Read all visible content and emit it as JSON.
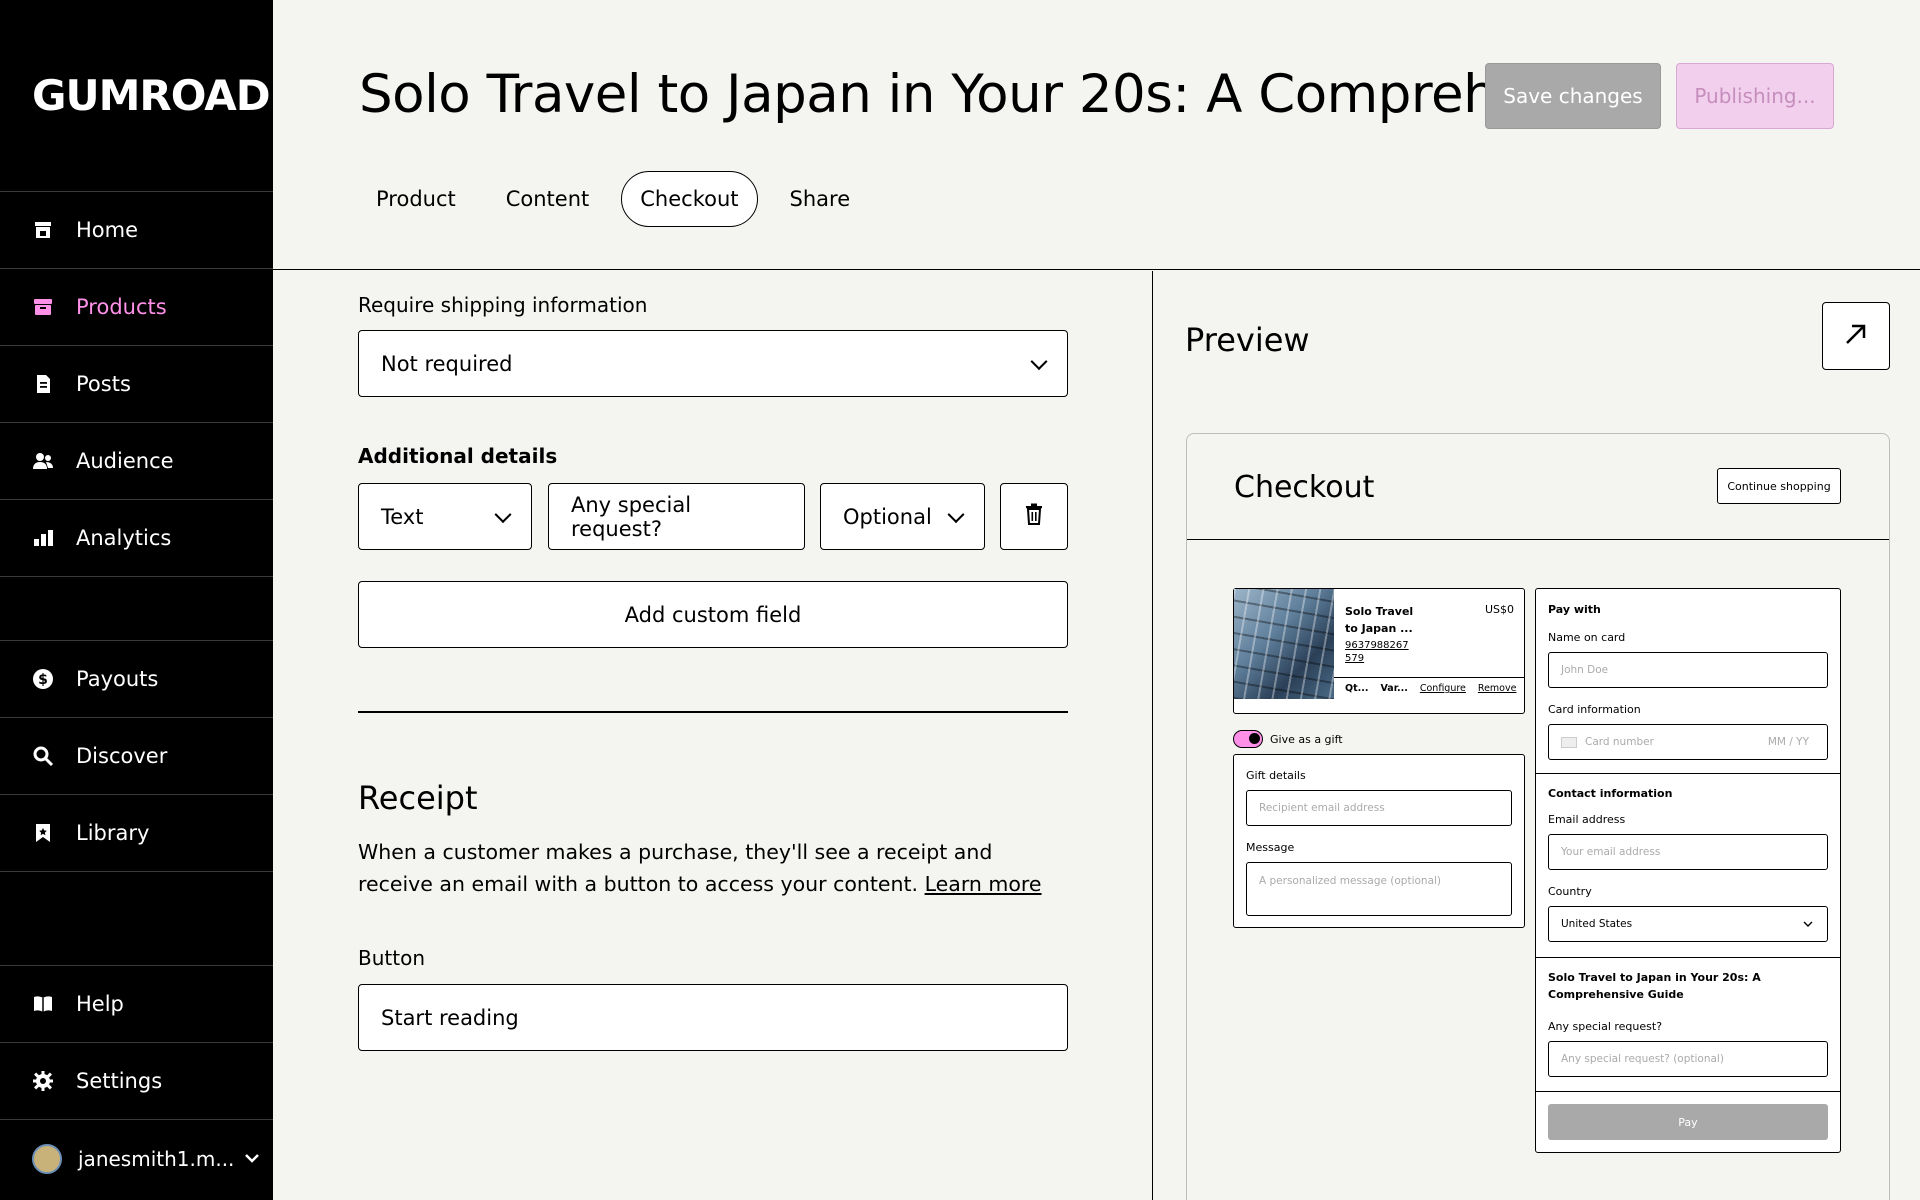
{
  "sidebar": {
    "logo": "Gumroad",
    "items": [
      {
        "label": "Home",
        "icon": "store-icon"
      },
      {
        "label": "Products",
        "icon": "archive-icon"
      },
      {
        "label": "Posts",
        "icon": "document-icon"
      },
      {
        "label": "Audience",
        "icon": "people-icon"
      },
      {
        "label": "Analytics",
        "icon": "bar-chart-icon"
      },
      {
        "label": "Payouts",
        "icon": "dollar-circle-icon"
      },
      {
        "label": "Discover",
        "icon": "search-icon"
      },
      {
        "label": "Library",
        "icon": "bookmark-icon"
      },
      {
        "label": "Help",
        "icon": "book-icon"
      },
      {
        "label": "Settings",
        "icon": "gear-icon"
      }
    ],
    "active_item": "Products",
    "user": "janesmith1.m..."
  },
  "header": {
    "title": "Solo Travel to Japan in Your 20s: A Compreh...",
    "save_label": "Save changes",
    "publish_label": "Publishing...",
    "tabs": [
      "Product",
      "Content",
      "Checkout",
      "Share"
    ],
    "active_tab": "Checkout"
  },
  "main": {
    "shipping_label": "Require shipping information",
    "shipping_value": "Not required",
    "additional_label": "Additional details",
    "field_type": "Text",
    "field_name": "Any special request?",
    "field_required": "Optional",
    "add_field_label": "Add custom field",
    "receipt_title": "Receipt",
    "receipt_text": "When a customer makes a purchase, they'll see a receipt and receive an email with a button to access your content.",
    "learn_more": "Learn more",
    "button_label": "Button",
    "button_value": "Start reading"
  },
  "preview": {
    "title": "Preview",
    "checkout_title": "Checkout",
    "continue_label": "Continue shopping",
    "cart": {
      "name": "Solo Travel to Japan ...",
      "price": "US$0",
      "code": "9637988267 579",
      "qty": "Qt...",
      "variant": "Var...",
      "configure": "Configure",
      "remove": "Remove"
    },
    "gift_label": "Give as a gift",
    "gift_details": "Gift details",
    "recipient_placeholder": "Recipient email address",
    "message_label": "Message",
    "message_placeholder": "A personalized message (optional)",
    "pay_with": "Pay with",
    "name_on_card": "Name on card",
    "name_placeholder": "John Doe",
    "card_info": "Card information",
    "card_number_placeholder": "Card number",
    "card_exp_placeholder": "MM / YY",
    "contact_info": "Contact information",
    "email_label": "Email address",
    "email_placeholder": "Your email address",
    "country_label": "Country",
    "country_value": "United States",
    "product_full_title": "Solo Travel to Japan in Your 20s: A Comprehensive Guide",
    "special_request_label": "Any special request?",
    "special_request_placeholder": "Any special request? (optional)",
    "pay_label": "Pay"
  },
  "colors": {
    "accent_pink": "#ff90e8",
    "sidebar_bg": "#000000",
    "page_bg": "#f4f4f0",
    "disabled_gray": "#a9a9a9"
  }
}
